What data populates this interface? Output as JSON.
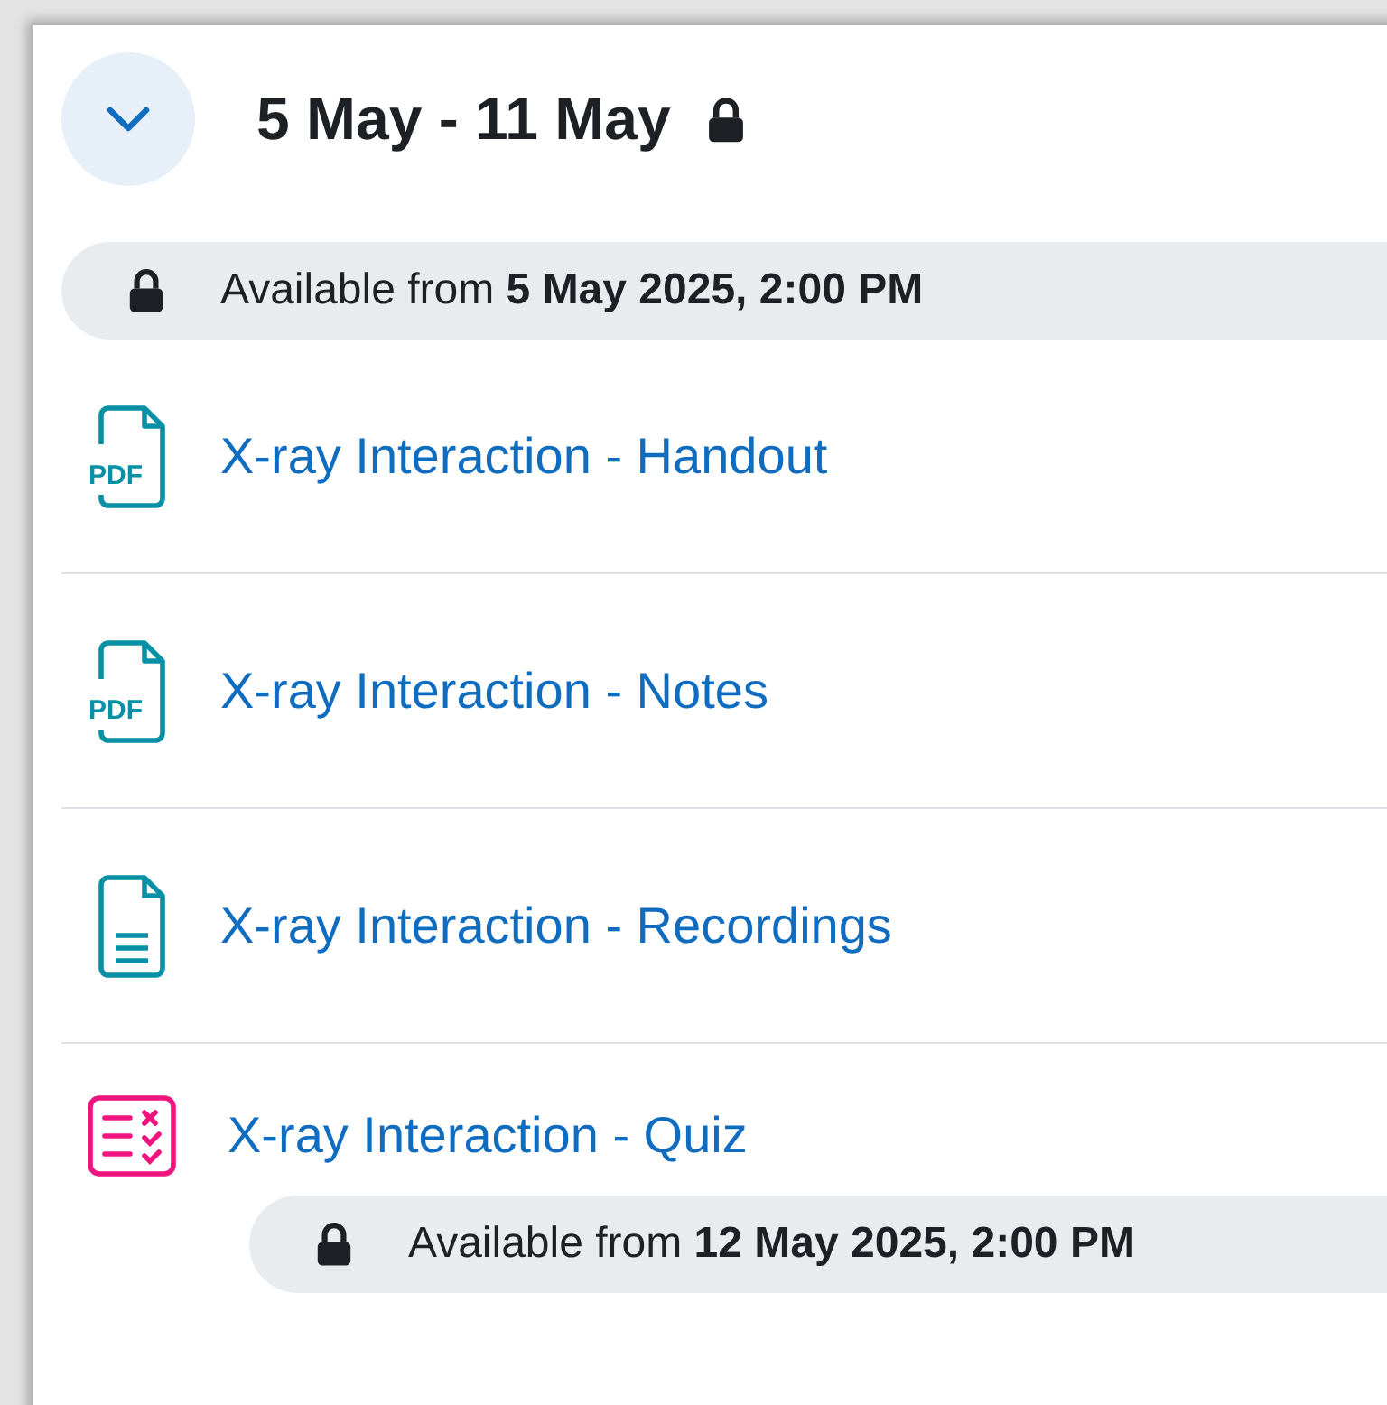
{
  "section": {
    "expanded": true,
    "title": "5 May - 11 May",
    "locked": true,
    "restriction": {
      "prefix": "Available from",
      "date": "5 May 2025, 2:00 PM"
    }
  },
  "activities": [
    {
      "kind": "pdf",
      "icon_label": "PDF",
      "title": "X-ray Interaction - Handout"
    },
    {
      "kind": "pdf",
      "icon_label": "PDF",
      "title": "X-ray Interaction - Notes"
    },
    {
      "kind": "file",
      "title": "X-ray Interaction - Recordings"
    },
    {
      "kind": "quiz",
      "title": "X-ray Interaction - Quiz",
      "restriction": {
        "prefix": "Available from",
        "date": "12 May 2025, 2:00 PM"
      }
    }
  ]
}
